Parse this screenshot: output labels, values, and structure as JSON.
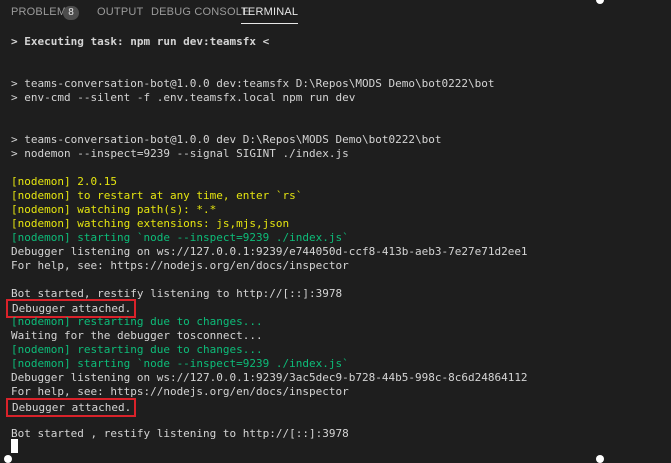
{
  "tabs": {
    "problems": "PROBLEMS",
    "problems_count": "8",
    "output": "OUTPUT",
    "debug_console": "DEBUG CONSOLE",
    "terminal": "TERMINAL",
    "active": "TERMINAL"
  },
  "terminal": {
    "colors": {
      "text": "#d4d4d4",
      "yellow": "#e5e510",
      "green": "#0dbc79",
      "highlight_box": "#d9222a"
    },
    "lines": [
      "> Executing task: npm run dev:teamsfx <",
      "> teams-conversation-bot@1.0.0 dev:teamsfx D:\\Repos\\MODS Demo\\bot0222\\bot",
      "> env-cmd --silent -f .env.teamsfx.local npm run dev",
      "> teams-conversation-bot@1.0.0 dev D:\\Repos\\MODS Demo\\bot0222\\bot",
      "> nodemon --inspect=9239 --signal SIGINT ./index.js",
      "[nodemon] 2.0.15",
      "[nodemon] to restart at any time, enter `rs`",
      "[nodemon] watching path(s): *.*",
      "[nodemon] watching extensions: js,mjs,json",
      "[nodemon] starting `node --inspect=9239 ./index.js`",
      "Debugger listening on ws://127.0.0.1:9239/e744050d-ccf8-413b-aeb3-7e27e71d2ee1",
      "For help, see: https://nodejs.org/en/docs/inspector",
      "Bot started, restify listening to http://[::]:3978",
      "Debugger attached.",
      "[nodemon] restarting due to changes...",
      "Waiting for the debugger tosconnect...",
      "[nodemon] restarting due to changes...",
      "[nodemon] starting `node --inspect=9239 ./index.js`",
      "Debugger listening on ws://127.0.0.1:9239/3ac5dec9-b728-44b5-998c-8c6d24864112",
      "For help, see: https://nodejs.org/en/docs/inspector",
      "Debugger attached.",
      "Bot started , restify listening to http://[::]:3978"
    ]
  }
}
